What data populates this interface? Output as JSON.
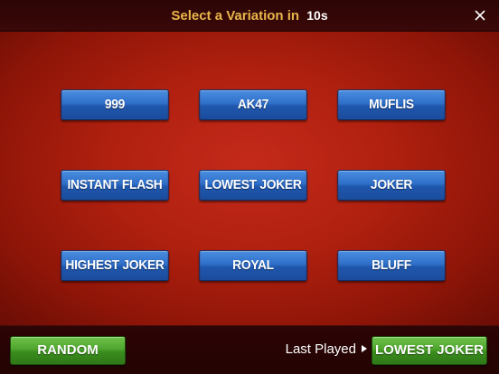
{
  "header": {
    "title": "Select a Variation in",
    "timer": "10s",
    "close_icon": "close-icon"
  },
  "variations": [
    {
      "label": "999"
    },
    {
      "label": "AK47"
    },
    {
      "label": "MUFLIS"
    },
    {
      "label": "INSTANT FLASH"
    },
    {
      "label": "LOWEST JOKER"
    },
    {
      "label": "JOKER"
    },
    {
      "label": "HIGHEST JOKER"
    },
    {
      "label": "ROYAL"
    },
    {
      "label": "BLUFF"
    }
  ],
  "footer": {
    "random_label": "RANDOM",
    "last_played_label": "Last Played",
    "last_played_value": "LOWEST JOKER"
  },
  "colors": {
    "title_gold": "#e8b64a",
    "felt_red": "#b0200f",
    "button_blue": "#2f6fc9",
    "button_green": "#4ea52d"
  }
}
